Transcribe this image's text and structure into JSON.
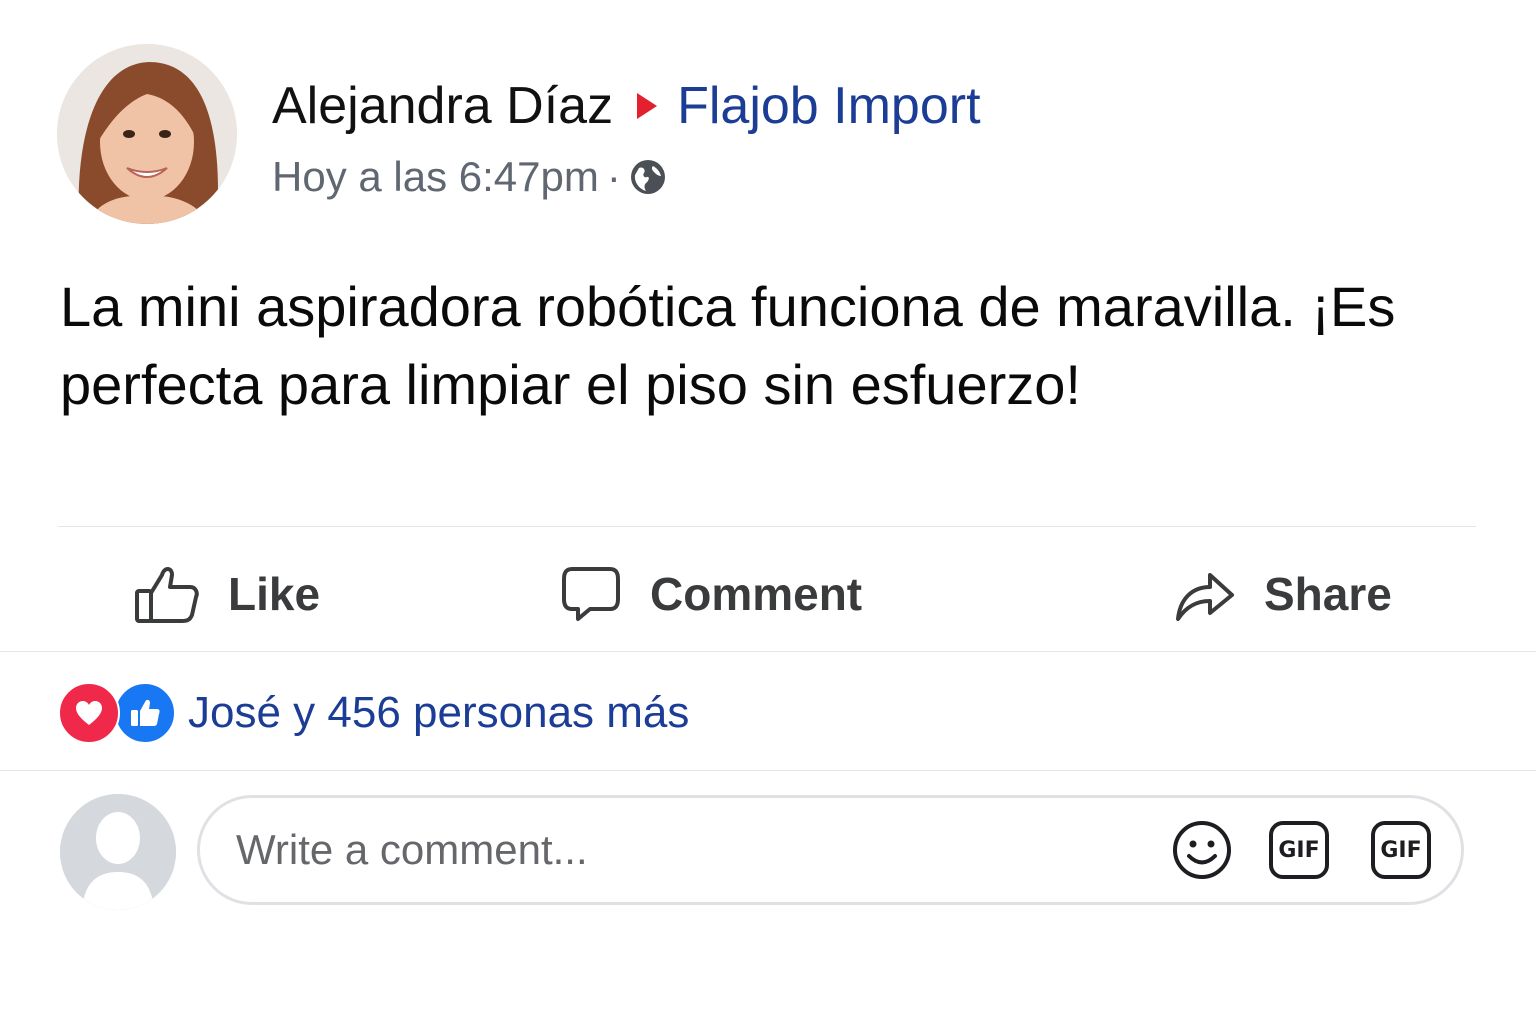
{
  "post": {
    "author_name": "Alejandra Díaz",
    "target_page": "Flajob Import",
    "timestamp": "Hoy a las 6:47pm",
    "separator": "·",
    "privacy_icon": "globe-icon",
    "text": "La mini aspiradora robótica funciona de maravilla. ¡Es perfecta para limpiar el piso sin esfuerzo!"
  },
  "actions": {
    "like_label": "Like",
    "comment_label": "Comment",
    "share_label": "Share"
  },
  "reactions": {
    "types": [
      "heart-reaction-icon",
      "like-reaction-icon"
    ],
    "summary": "José y 456 personas más"
  },
  "composer": {
    "placeholder": "Write a comment...",
    "gif_label": "GIF",
    "gif_label_2": "GIF"
  },
  "colors": {
    "link_blue": "#1c3d96",
    "arrow_red": "#e4202f",
    "heart_red": "#f0284a",
    "like_blue": "#1877f2",
    "muted_text": "#606770"
  }
}
